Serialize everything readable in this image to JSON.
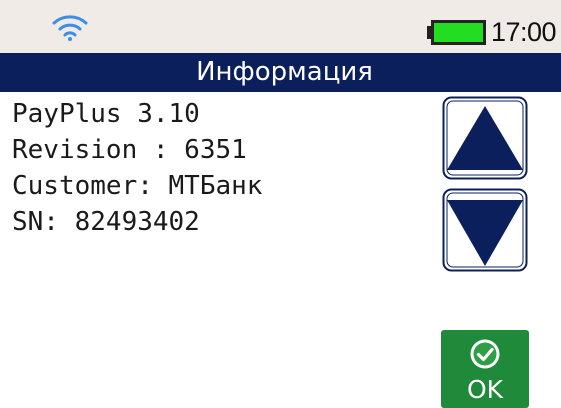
{
  "status_bar": {
    "wifi_icon": "wifi-icon",
    "battery_icon": "battery-icon",
    "battery_level": 1.0,
    "time": "17:00"
  },
  "title": "Информация",
  "info": {
    "lines": [
      "PayPlus 3.10",
      "Revision : 6351",
      "Customer: МТБанк",
      "SN: 82493402"
    ]
  },
  "buttons": {
    "scroll_up_icon": "arrow-up-icon",
    "scroll_down_icon": "arrow-down-icon",
    "ok_label": "OK",
    "ok_icon": "check-circle-icon"
  },
  "colors": {
    "title_bar": "#0b1f5c",
    "arrow": "#0b1f5c",
    "ok_button": "#1e8a3a",
    "battery_fill": "#22dd22",
    "wifi": "#3a8ee6",
    "status_bar": "#f0ebe7"
  }
}
